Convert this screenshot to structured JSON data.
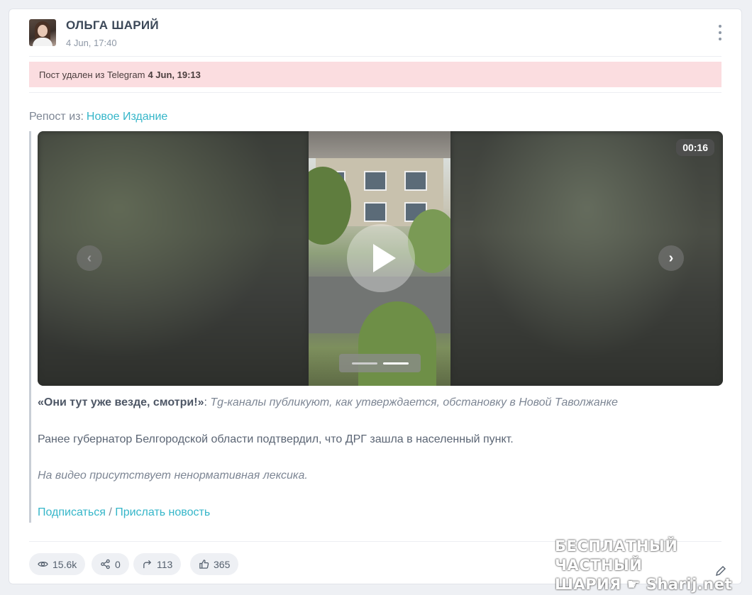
{
  "post": {
    "author": "ОЛЬГА ШАРИЙ",
    "date": "4 Jun, 17:40",
    "deleted_notice": "Пост удален из Telegram",
    "deleted_date": "4 Jun, 19:13",
    "repost_label": "Репост из:",
    "repost_source": "Новое Издание"
  },
  "video": {
    "duration": "00:16",
    "slides": 2,
    "active_slide": 2
  },
  "body": {
    "quote_bold": "«Они тут уже везде, смотри!»",
    "quote_colon": ":",
    "quote_rest": "Tg-каналы публикуют, как утверждается, обстановку в Новой Таволжанке",
    "para2": "Ранее губернатор Белгородской области подтвердил, что ДРГ зашла в населенный пункт.",
    "para3": "На видео присутствует ненормативная лексика.",
    "link_subscribe": "Подписаться",
    "link_separator": "/",
    "link_send": "Прислать новость"
  },
  "stats": {
    "views": "15.6k",
    "shares": "0",
    "forwards": "113",
    "likes": "365"
  },
  "watermark": {
    "line1": "БЕСПЛАТНЫЙ ЧАСТНЫЙ",
    "line2": "ШАРИЯ",
    "line2_site": "Sharij.net"
  }
}
